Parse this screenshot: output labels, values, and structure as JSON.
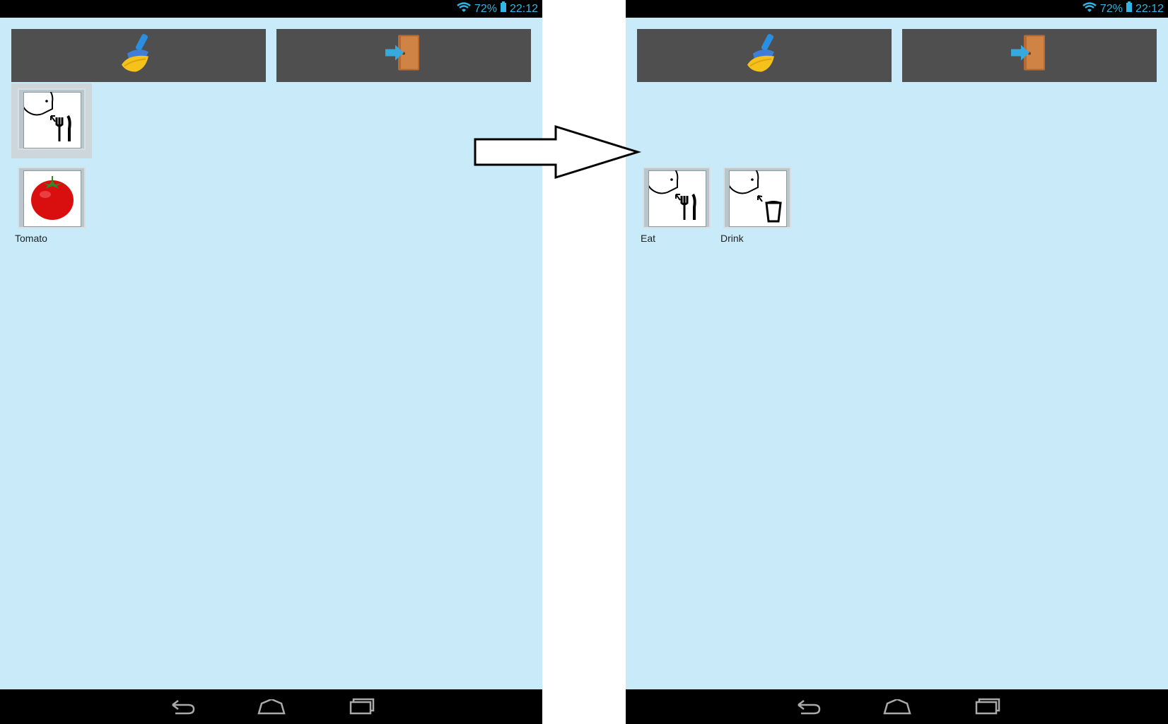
{
  "status": {
    "battery": "72%",
    "time": "22:12"
  },
  "left_screen": {
    "toolbar": {
      "clear_icon": "broom-icon",
      "exit_icon": "exit-door-icon"
    },
    "selected_tile": {
      "icon": "eat-pictogram-icon"
    },
    "items": [
      {
        "label": "Tomato",
        "icon": "tomato-icon"
      }
    ]
  },
  "right_screen": {
    "toolbar": {
      "clear_icon": "broom-icon",
      "exit_icon": "exit-door-icon"
    },
    "items": [
      {
        "label": "Eat",
        "icon": "eat-pictogram-icon"
      },
      {
        "label": "Drink",
        "icon": "drink-pictogram-icon"
      }
    ]
  },
  "colors": {
    "screen_bg": "#c9eaf8",
    "toolbar_btn": "#4f4f4f",
    "status_text": "#33b5e5"
  },
  "nav": {
    "icons": [
      "back-icon",
      "home-icon",
      "recent-apps-icon"
    ]
  }
}
